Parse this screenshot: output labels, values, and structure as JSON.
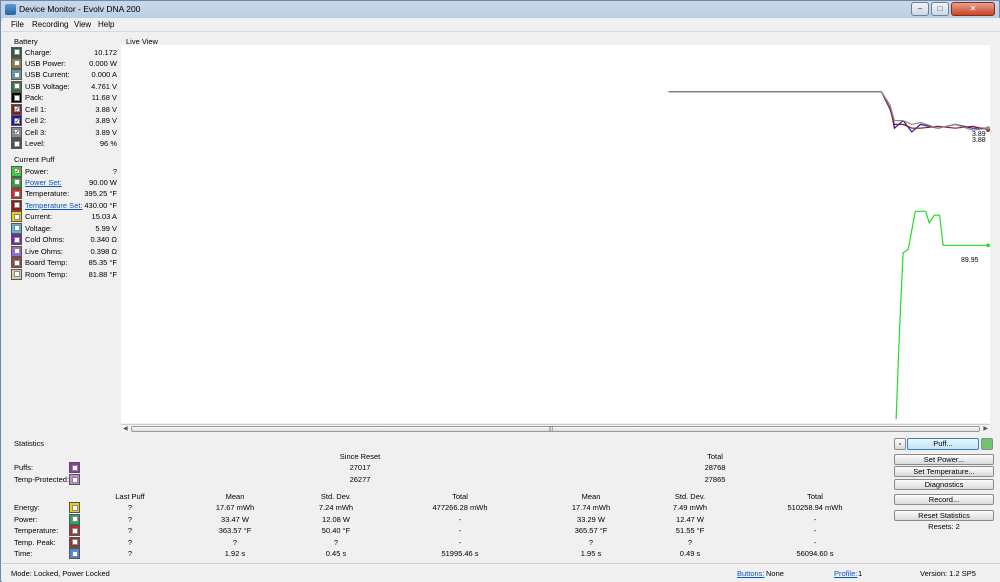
{
  "window": {
    "title": "Device Monitor - Evolv DNA 200"
  },
  "menu": [
    "File",
    "Recording",
    "View",
    "Help"
  ],
  "battery": {
    "title": "Battery",
    "rows": [
      {
        "label": "Charge:",
        "value": "10.172",
        "color": "#2e5b45",
        "checked": false
      },
      {
        "label": "USB Power:",
        "value": "0.000 W",
        "color": "#8f7b3a",
        "checked": false
      },
      {
        "label": "USB Current:",
        "value": "0.000 A",
        "color": "#5b9bb0",
        "checked": false
      },
      {
        "label": "USB Voltage:",
        "value": "4.761 V",
        "color": "#2f7a3a",
        "checked": false
      },
      {
        "label": "Pack:",
        "value": "11.68 V",
        "color": "#000000",
        "checked": false
      },
      {
        "label": "Cell 1:",
        "value": "3.88 V",
        "color": "#8b1a1a",
        "checked": true
      },
      {
        "label": "Cell 2:",
        "value": "3.89 V",
        "color": "#1a1aa8",
        "checked": true
      },
      {
        "label": "Cell 3:",
        "value": "3.89 V",
        "color": "#8a8a8a",
        "checked": true
      },
      {
        "label": "Level:",
        "value": "96 %",
        "color": "#3a5a50",
        "checked": false
      }
    ]
  },
  "puff": {
    "title": "Current Puff",
    "rows": [
      {
        "label": "Power:",
        "value": "?",
        "color": "#22dd22",
        "checked": true,
        "link": false
      },
      {
        "label": "Power Set:",
        "value": "90.00 W",
        "color": "#22aa22",
        "checked": false,
        "link": true
      },
      {
        "label": "Temperature:",
        "value": "395.25 °F",
        "color": "#dd2222",
        "checked": false,
        "link": false
      },
      {
        "label": "Temperature Set:",
        "value": "430.00 °F",
        "color": "#aa1111",
        "checked": false,
        "link": true
      },
      {
        "label": "Current:",
        "value": "15.03 A",
        "color": "#eecc11",
        "checked": false,
        "link": false
      },
      {
        "label": "Voltage:",
        "value": "5.99 V",
        "color": "#55bbdd",
        "checked": false,
        "link": false
      },
      {
        "label": "Cold Ohms:",
        "value": "0.340 Ω",
        "color": "#7722aa",
        "checked": false,
        "link": false
      },
      {
        "label": "Live Ohms:",
        "value": "0.398 Ω",
        "color": "#9966dd",
        "checked": false,
        "link": false
      },
      {
        "label": "Board Temp:",
        "value": "85.35 °F",
        "color": "#994444",
        "checked": false,
        "link": false
      },
      {
        "label": "Room Temp:",
        "value": "81.88 °F",
        "color": "#e0c8a8",
        "checked": false,
        "link": false
      }
    ]
  },
  "live_view": {
    "title": "Live View",
    "labels": {
      "cell_top": "3.89",
      "cell_bottom": "3.88",
      "power": "89.95"
    }
  },
  "chart_data": {
    "type": "line",
    "xlim": [
      0,
      100
    ],
    "ylim": [
      0,
      100
    ],
    "series": [
      {
        "color": "#1a1aa8",
        "x": [
          63,
          87.5,
          88.5,
          89,
          90,
          91,
          92,
          94,
          96,
          98,
          100
        ],
        "y": [
          87.6,
          87.6,
          84,
          78,
          80,
          77,
          79,
          78,
          79,
          78,
          78
        ]
      },
      {
        "color": "#8b1a1a",
        "x": [
          63,
          87.5,
          88.5,
          89,
          90,
          91,
          92,
          94,
          96,
          98,
          100
        ],
        "y": [
          87.6,
          87.6,
          83,
          79,
          79,
          78,
          78,
          78.5,
          78,
          78.5,
          77.5
        ]
      },
      {
        "color": "#8a8a8a",
        "x": [
          63,
          87.5,
          88.5,
          89,
          90,
          91,
          92,
          94,
          96,
          98,
          100
        ],
        "y": [
          87.6,
          87.6,
          84,
          80,
          80,
          79,
          79.5,
          78,
          79,
          77.5,
          78
        ]
      },
      {
        "color": "#22dd22",
        "x": [
          89.2,
          89.6,
          90,
          90.6,
          91.4,
          92.6,
          93,
          93.6,
          94.2,
          94.6,
          100
        ],
        "y": [
          1,
          25,
          45,
          46,
          56,
          56,
          53,
          55,
          55,
          47,
          47
        ]
      }
    ]
  },
  "stats": {
    "title": "Statistics",
    "since_reset": "Since Reset",
    "total_h": "Total",
    "puffs": {
      "label": "Puffs:",
      "since": "27017",
      "total": "28768",
      "color": "#9933aa"
    },
    "temp_protected": {
      "label": "Temp-Protected:",
      "since": "26277",
      "total": "27865",
      "color": "#cc88dd"
    },
    "headers": [
      "Last Puff",
      "Mean",
      "Std. Dev.",
      "Total",
      "Mean",
      "Std. Dev.",
      "Total"
    ],
    "rows": [
      {
        "label": "Energy:",
        "color": "#eecc11",
        "v": [
          "?",
          "17.67 mWh",
          "7.24 mWh",
          "477266.28 mWh",
          "17.74 mWh",
          "7.49 mWh",
          "510258.94 mWh"
        ]
      },
      {
        "label": "Power:",
        "color": "#22aa55",
        "v": [
          "?",
          "33.47 W",
          "12.08 W",
          "-",
          "33.29 W",
          "12.47 W",
          "-"
        ]
      },
      {
        "label": "Temperature:",
        "color": "#aa3333",
        "v": [
          "?",
          "363.57 °F",
          "50.40 °F",
          "-",
          "365.57 °F",
          "51.55 °F",
          "-"
        ]
      },
      {
        "label": "Temp. Peak:",
        "color": "#993333",
        "v": [
          "?",
          "?",
          "?",
          "-",
          "?",
          "?",
          "-"
        ]
      },
      {
        "label": "Time:",
        "color": "#4488ee",
        "v": [
          "?",
          "1.92 s",
          "0.45 s",
          "51995.46 s",
          "1.95 s",
          "0.49 s",
          "56094.60 s"
        ]
      }
    ]
  },
  "buttons": {
    "puff": "Puff...",
    "set_power": "Set Power...",
    "set_temperature": "Set Temperature...",
    "diagnostics": "Diagnostics",
    "record": "Record...",
    "reset_statistics": "Reset Statistics",
    "resets": "Resets: 2"
  },
  "status": {
    "mode": "Mode: Locked, Power Locked",
    "buttons_label": "Buttons:",
    "buttons_value": "None",
    "profile_label": "Profile:",
    "profile_value": "1",
    "version": "Version: 1.2 SP5"
  }
}
